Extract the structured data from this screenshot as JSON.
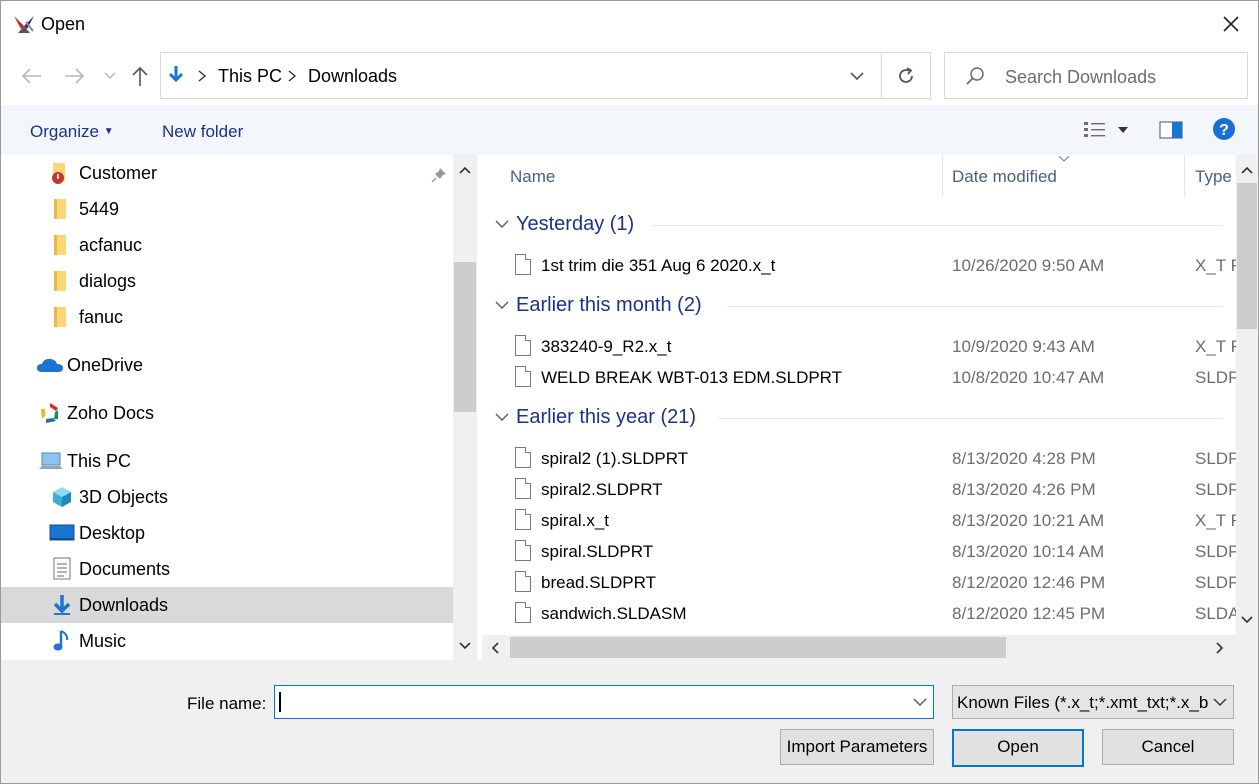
{
  "window": {
    "title": "Open"
  },
  "address": {
    "crumbs": [
      "This PC",
      "Downloads"
    ]
  },
  "search": {
    "placeholder": "Search Downloads"
  },
  "toolbar": {
    "organize_label": "Organize",
    "new_folder_label": "New folder"
  },
  "sidebar": {
    "items": [
      {
        "label": "Customer",
        "icon": "folder-alert-icon"
      },
      {
        "label": "5449",
        "icon": "folder-icon"
      },
      {
        "label": "acfanuc",
        "icon": "folder-icon"
      },
      {
        "label": "dialogs",
        "icon": "folder-icon"
      },
      {
        "label": "fanuc",
        "icon": "folder-icon"
      },
      {
        "label": "OneDrive",
        "icon": "cloud-icon"
      },
      {
        "label": "Zoho Docs",
        "icon": "zoho-icon"
      },
      {
        "label": "This PC",
        "icon": "computer-icon"
      },
      {
        "label": "3D Objects",
        "icon": "cube-icon"
      },
      {
        "label": "Desktop",
        "icon": "desktop-icon"
      },
      {
        "label": "Documents",
        "icon": "document-icon"
      },
      {
        "label": "Downloads",
        "icon": "download-icon",
        "selected": true
      },
      {
        "label": "Music",
        "icon": "music-icon"
      }
    ]
  },
  "columns": {
    "name": "Name",
    "date": "Date modified",
    "type": "Type"
  },
  "groups": [
    {
      "label": "Yesterday (1)",
      "files": [
        {
          "name": "1st trim die 351 Aug 6 2020.x_t",
          "date": "10/26/2020 9:50 AM",
          "type": "X_T F"
        }
      ]
    },
    {
      "label": "Earlier this month (2)",
      "files": [
        {
          "name": "383240-9_R2.x_t",
          "date": "10/9/2020 9:43 AM",
          "type": "X_T F"
        },
        {
          "name": "WELD BREAK WBT-013 EDM.SLDPRT",
          "date": "10/8/2020 10:47 AM",
          "type": "SLDP"
        }
      ]
    },
    {
      "label": "Earlier this year (21)",
      "files": [
        {
          "name": "spiral2 (1).SLDPRT",
          "date": "8/13/2020 4:28 PM",
          "type": "SLDP"
        },
        {
          "name": "spiral2.SLDPRT",
          "date": "8/13/2020 4:26 PM",
          "type": "SLDP"
        },
        {
          "name": "spiral.x_t",
          "date": "8/13/2020 10:21 AM",
          "type": "X_T F"
        },
        {
          "name": "spiral.SLDPRT",
          "date": "8/13/2020 10:14 AM",
          "type": "SLDP"
        },
        {
          "name": "bread.SLDPRT",
          "date": "8/12/2020 12:46 PM",
          "type": "SLDP"
        },
        {
          "name": "sandwich.SLDASM",
          "date": "8/12/2020 12:45 PM",
          "type": "SLDA"
        }
      ]
    }
  ],
  "footer": {
    "file_name_label": "File name:",
    "file_name_value": "",
    "file_type": "Known Files (*.x_t;*.xmt_txt;*.x_b",
    "import_label": "Import Parameters",
    "open_label": "Open",
    "cancel_label": "Cancel"
  },
  "colors": {
    "accent": "#0078d7",
    "link_blue": "#1e3287",
    "selection": "#d9d9d9"
  }
}
